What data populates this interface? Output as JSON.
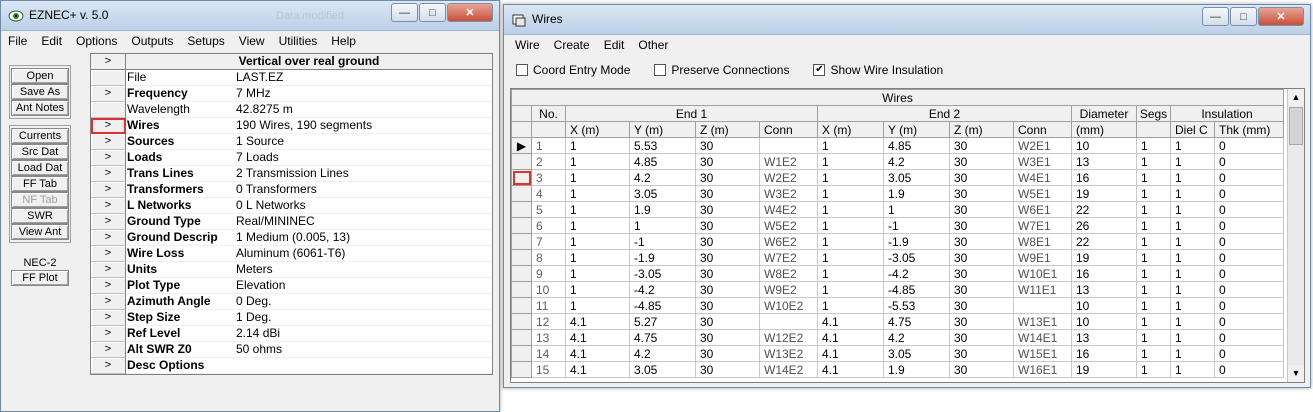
{
  "ez": {
    "title": "EZNEC+  v. 5.0",
    "faded_title": "Data modified",
    "menu": [
      "File",
      "Edit",
      "Options",
      "Outputs",
      "Setups",
      "View",
      "Utilities",
      "Help"
    ],
    "buttons_a": [
      "Open",
      "Save As",
      "Ant Notes"
    ],
    "buttons_b": [
      "Currents",
      "Src Dat",
      "Load Dat",
      "FF Tab",
      "NF Tab",
      "SWR",
      "View Ant"
    ],
    "nec_label": "NEC-2",
    "ff_plot": "FF Plot",
    "grid_title": "Vertical over real ground",
    "arrow": ">",
    "rows": [
      {
        "label": "File",
        "value": "LAST.EZ",
        "bold": false,
        "arrow": false
      },
      {
        "label": "Frequency",
        "value": "7 MHz",
        "bold": true,
        "arrow": true
      },
      {
        "label": "Wavelength",
        "value": "42.8275 m",
        "bold": false,
        "arrow": false
      },
      {
        "label": "Wires",
        "value": "190 Wires, 190 segments",
        "bold": true,
        "arrow": true,
        "highlight": true
      },
      {
        "label": "Sources",
        "value": "1 Source",
        "bold": true,
        "arrow": true
      },
      {
        "label": "Loads",
        "value": "7 Loads",
        "bold": true,
        "arrow": true
      },
      {
        "label": "Trans Lines",
        "value": "2 Transmission Lines",
        "bold": true,
        "arrow": true
      },
      {
        "label": "Transformers",
        "value": "0 Transformers",
        "bold": true,
        "arrow": true
      },
      {
        "label": "L Networks",
        "value": "0 L Networks",
        "bold": true,
        "arrow": true
      },
      {
        "label": "Ground Type",
        "value": "Real/MININEC",
        "bold": true,
        "arrow": true
      },
      {
        "label": "Ground Descrip",
        "value": "1 Medium (0.005, 13)",
        "bold": true,
        "arrow": true
      },
      {
        "label": "Wire Loss",
        "value": "Aluminum (6061-T6)",
        "bold": true,
        "arrow": true
      },
      {
        "label": "Units",
        "value": "Meters",
        "bold": true,
        "arrow": true
      },
      {
        "label": "Plot Type",
        "value": "Elevation",
        "bold": true,
        "arrow": true
      },
      {
        "label": "Azimuth Angle",
        "value": "0 Deg.",
        "bold": true,
        "arrow": true
      },
      {
        "label": "Step Size",
        "value": "1 Deg.",
        "bold": true,
        "arrow": true
      },
      {
        "label": "Ref Level",
        "value": "2.14 dBi",
        "bold": true,
        "arrow": true
      },
      {
        "label": "Alt SWR Z0",
        "value": "50 ohms",
        "bold": true,
        "arrow": true
      },
      {
        "label": "Desc Options",
        "value": "",
        "bold": true,
        "arrow": true
      }
    ]
  },
  "wires": {
    "title": "Wires",
    "menu": [
      "Wire",
      "Create",
      "Edit",
      "Other"
    ],
    "checks": [
      {
        "label": "Coord Entry Mode",
        "checked": false
      },
      {
        "label": "Preserve Connections",
        "checked": false
      },
      {
        "label": "Show Wire Insulation",
        "checked": true
      }
    ],
    "table_title": "Wires",
    "groups": {
      "no": "No.",
      "end1": "End 1",
      "end2": "End 2",
      "diameter": "Diameter",
      "segs": "Segs",
      "insulation": "Insulation"
    },
    "columns": [
      "X (m)",
      "Y (m)",
      "Z (m)",
      "Conn",
      "X (m)",
      "Y (m)",
      "Z (m)",
      "Conn",
      "(mm)",
      "",
      "Diel C",
      "Thk (mm)"
    ],
    "rows": [
      [
        "1",
        "1",
        "5.53",
        "30",
        "",
        "1",
        "4.85",
        "30",
        "W2E1",
        "10",
        "1",
        "1",
        "0"
      ],
      [
        "2",
        "1",
        "4.85",
        "30",
        "W1E2",
        "1",
        "4.2",
        "30",
        "W3E1",
        "13",
        "1",
        "1",
        "0"
      ],
      [
        "3",
        "1",
        "4.2",
        "30",
        "W2E2",
        "1",
        "3.05",
        "30",
        "W4E1",
        "16",
        "1",
        "1",
        "0"
      ],
      [
        "4",
        "1",
        "3.05",
        "30",
        "W3E2",
        "1",
        "1.9",
        "30",
        "W5E1",
        "19",
        "1",
        "1",
        "0"
      ],
      [
        "5",
        "1",
        "1.9",
        "30",
        "W4E2",
        "1",
        "1",
        "30",
        "W6E1",
        "22",
        "1",
        "1",
        "0"
      ],
      [
        "6",
        "1",
        "1",
        "30",
        "W5E2",
        "1",
        "-1",
        "30",
        "W7E1",
        "26",
        "1",
        "1",
        "0"
      ],
      [
        "7",
        "1",
        "-1",
        "30",
        "W6E2",
        "1",
        "-1.9",
        "30",
        "W8E1",
        "22",
        "1",
        "1",
        "0"
      ],
      [
        "8",
        "1",
        "-1.9",
        "30",
        "W7E2",
        "1",
        "-3.05",
        "30",
        "W9E1",
        "19",
        "1",
        "1",
        "0"
      ],
      [
        "9",
        "1",
        "-3.05",
        "30",
        "W8E2",
        "1",
        "-4.2",
        "30",
        "W10E1",
        "16",
        "1",
        "1",
        "0"
      ],
      [
        "10",
        "1",
        "-4.2",
        "30",
        "W9E2",
        "1",
        "-4.85",
        "30",
        "W11E1",
        "13",
        "1",
        "1",
        "0"
      ],
      [
        "11",
        "1",
        "-4.85",
        "30",
        "W10E2",
        "1",
        "-5.53",
        "30",
        "",
        "10",
        "1",
        "1",
        "0"
      ],
      [
        "12",
        "4.1",
        "5.27",
        "30",
        "",
        "4.1",
        "4.75",
        "30",
        "W13E1",
        "10",
        "1",
        "1",
        "0"
      ],
      [
        "13",
        "4.1",
        "4.75",
        "30",
        "W12E2",
        "4.1",
        "4.2",
        "30",
        "W14E1",
        "13",
        "1",
        "1",
        "0"
      ],
      [
        "14",
        "4.1",
        "4.2",
        "30",
        "W13E2",
        "4.1",
        "3.05",
        "30",
        "W15E1",
        "16",
        "1",
        "1",
        "0"
      ],
      [
        "15",
        "4.1",
        "3.05",
        "30",
        "W14E2",
        "4.1",
        "1.9",
        "30",
        "W16E1",
        "19",
        "1",
        "1",
        "0"
      ]
    ]
  }
}
